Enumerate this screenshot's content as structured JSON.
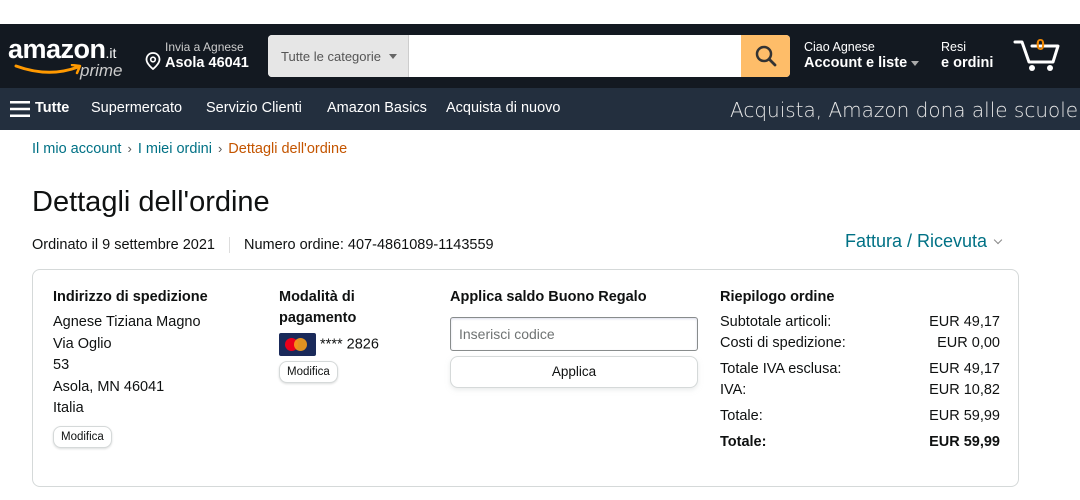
{
  "header": {
    "logo_text": "amazon",
    "logo_tld": ".it",
    "logo_prime": "prime",
    "deliver_line1": "Invia a Agnese",
    "deliver_line2": "Asola 46041",
    "search_category": "Tutte le categorie",
    "search_placeholder": "",
    "account_line1": "Ciao Agnese",
    "account_line2": "Account e liste",
    "orders_line1": "Resi",
    "orders_line2": "e ordini",
    "cart_count": "0"
  },
  "subnav": {
    "all_label": "Tutte",
    "items": [
      "Supermercato",
      "Servizio Clienti",
      "Amazon Basics",
      "Acquista di nuovo"
    ],
    "promo": "Acquista, Amazon dona alle scuole"
  },
  "breadcrumb": {
    "items": [
      "Il mio account",
      "I miei ordini"
    ],
    "current": "Dettagli dell'ordine",
    "separator": "›"
  },
  "page": {
    "title": "Dettagli dell'ordine",
    "ordered_on": "Ordinato il 9 settembre 2021",
    "order_number": "Numero ordine: 407-4861089-1143559",
    "invoice_link": "Fattura / Ricevuta"
  },
  "shipping": {
    "heading": "Indirizzo di spedizione",
    "lines": [
      "Agnese Tiziana Magno",
      "Via Oglio",
      "53",
      "Asola, MN 46041",
      "Italia"
    ],
    "edit_label": "Modifica"
  },
  "payment": {
    "heading": "Modalità di pagamento",
    "card_masked": "**** 2826",
    "edit_label": "Modifica"
  },
  "gift": {
    "heading": "Applica saldo Buono Regalo",
    "placeholder": "Inserisci codice",
    "apply_label": "Applica"
  },
  "summary": {
    "heading": "Riepilogo ordine",
    "rows": [
      {
        "label": "Subtotale articoli:",
        "value": "EUR 49,17"
      },
      {
        "label": "Costi di spedizione:",
        "value": "EUR 0,00"
      },
      {
        "label": "Totale IVA esclusa:",
        "value": "EUR 49,17"
      },
      {
        "label": "IVA:",
        "value": "EUR 10,82"
      },
      {
        "label": "Totale:",
        "value": "EUR 59,99"
      }
    ],
    "grand_total_label": "Totale:",
    "grand_total_value": "EUR 59,99"
  },
  "colors": {
    "nav_bg": "#131921",
    "subnav_bg": "#232f3e",
    "link": "#007185",
    "breadcrumb_current": "#c45500",
    "search_button": "#febd69"
  }
}
